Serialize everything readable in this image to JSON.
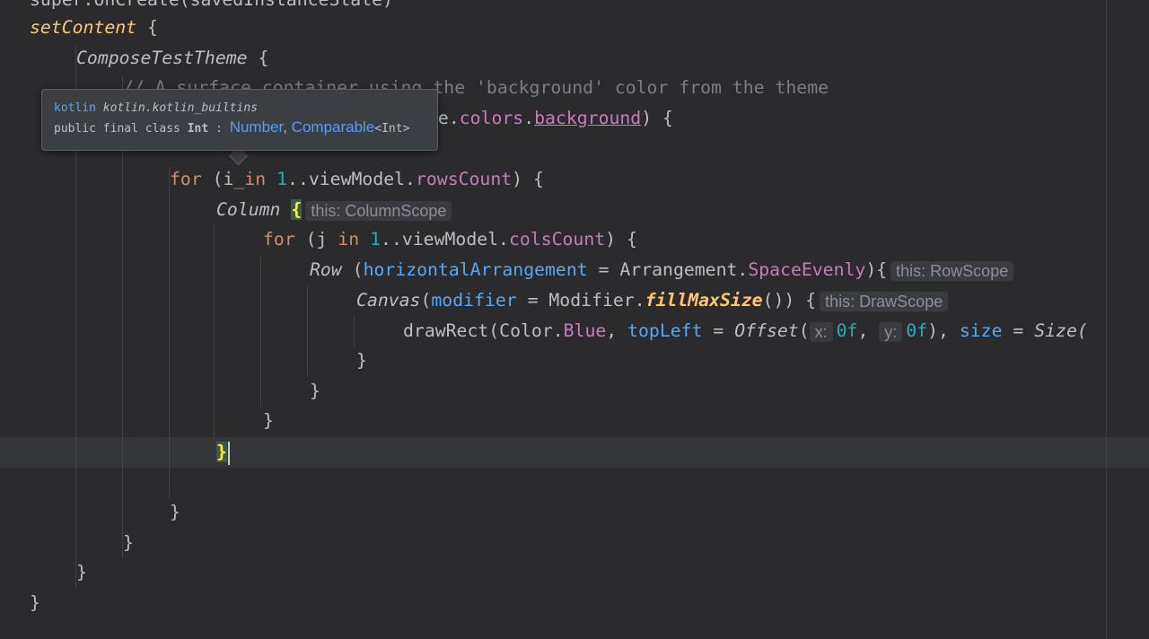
{
  "editor": {
    "lines": {
      "l0": "super.onCreate(savedInstanceState)",
      "l1_fn": "setContent",
      "l1_rest": " {",
      "l2_comp": "ComposeTestTheme",
      "l2_rest": " {",
      "l3": "// A surface container using the 'background' color from the theme",
      "l4_prefix": "me.",
      "l4_colors": "colors",
      "l4_dot": ".",
      "l4_bg": "background",
      "l4_rest": ") {",
      "l6_kw": "for",
      "l6_a": " (i",
      "l6_in": "_in",
      "l6_sp": " ",
      "l6_num": "1",
      "l6_b": "..viewModel.",
      "l6_prop": "rowsCount",
      "l6_c": ") {",
      "l7_comp": "Column",
      "l7_sp": " ",
      "l7_brace": "{",
      "l7_hint": "this: ColumnScope",
      "l8_kw": "for",
      "l8_a": " (j ",
      "l8_in": "in",
      "l8_sp": " ",
      "l8_num": "1",
      "l8_b": "..viewModel.",
      "l8_prop": "colsCount",
      "l8_c": ") {",
      "l9_comp": "Row",
      "l9_a": " (",
      "l9_param": "horizontalArrangement",
      "l9_b": " = Arrangement.",
      "l9_prop": "SpaceEvenly",
      "l9_c": "){",
      "l9_hint": "this: RowScope",
      "l10_comp": "Canvas",
      "l10_a": "(",
      "l10_param": "modifier",
      "l10_b": " = Modifier.",
      "l10_ext": "fillMaxSize",
      "l10_c": "()) {",
      "l10_hint": "this: DrawScope",
      "l11_a": "drawRect(Color.",
      "l11_prop": "Blue",
      "l11_b": ", ",
      "l11_param": "topLeft",
      "l11_c": " = ",
      "l11_offset": "Offset",
      "l11_d": "(",
      "l11_hx": "x:",
      "l11_num1": "0f",
      "l11_e": ", ",
      "l11_hy": "y:",
      "l11_num2": "0f",
      "l11_f": "), ",
      "l11_param2": "size",
      "l11_g": " = ",
      "l11_size": "Size(",
      "l12": "}",
      "l13": "}",
      "l14": "}",
      "l15": "}",
      "l17": "}",
      "l18": "}",
      "l19": "}",
      "l20": "}"
    }
  },
  "tooltip": {
    "pkg_kw": "kotlin",
    "pkg_name": "kotlin.kotlin_builtins",
    "decl_mods": "public final class ",
    "decl_name": "Int",
    "decl_colon": " : ",
    "super1": "Number",
    "comma": ", ",
    "super2": "Comparable",
    "generic": "<Int>"
  }
}
